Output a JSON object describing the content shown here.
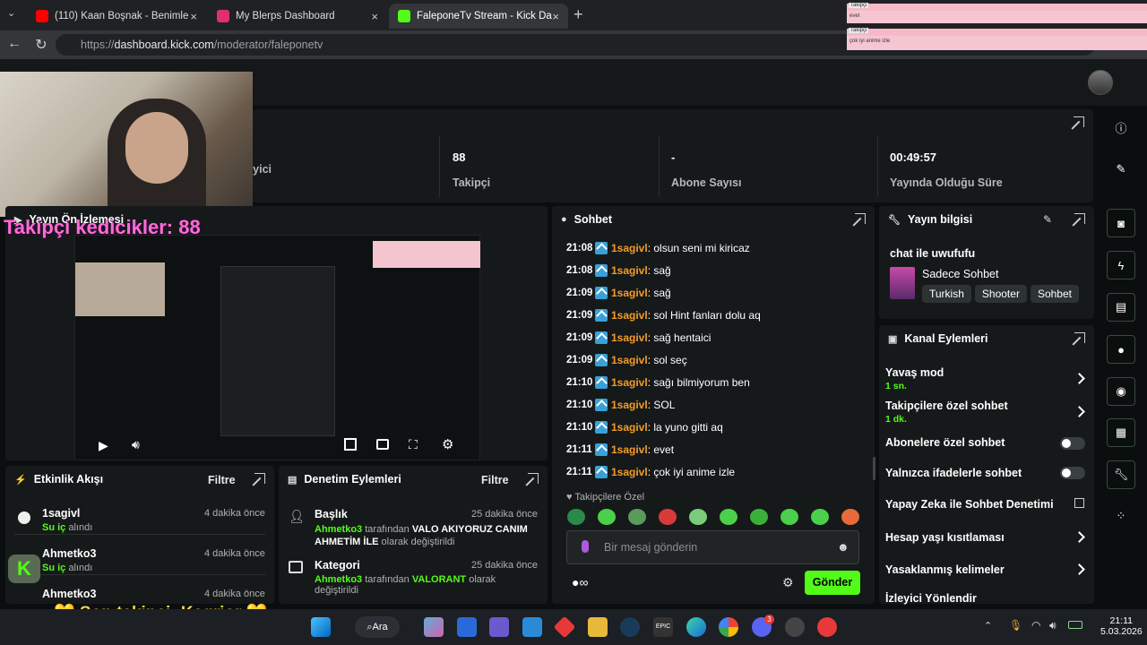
{
  "browser": {
    "tabs": [
      {
        "title": "(110) Kaan Boşnak - Benimle Kaybo",
        "color": "#ff0000"
      },
      {
        "title": "My Blerps Dashboard",
        "color": "#e0306b"
      },
      {
        "title": "FaleponeTv Stream - Kick Dashboa",
        "color": "#53fc18"
      }
    ],
    "url_prefix": "https://",
    "url_host": "dashboard.kick.com",
    "url_path": "/moderator/faleponetv",
    "new_tab": "+"
  },
  "overlay": {
    "notif1_user": "Takipçi",
    "notif1_text": "evet",
    "notif2_user": "Takipçi",
    "notif2_text": "çok iyi anime izle",
    "follower_goal": "Takipçi kedicikler: 88",
    "last_follower": "💛 Son takipçi: Kagrior 💛"
  },
  "stats": [
    {
      "value": "",
      "label": "İzleyici"
    },
    {
      "value": "88",
      "label": "Takipçi"
    },
    {
      "value": "-",
      "label": "Abone Sayısı"
    },
    {
      "value": "00:49:57",
      "label": "Yayında Olduğu Süre"
    }
  ],
  "preview": {
    "title": "Yayın Ön İzlemesi"
  },
  "chat": {
    "title": "Sohbet",
    "messages": [
      {
        "time": "21:08",
        "user": "1sagivl",
        "text": ": olsun seni mi kiricaz"
      },
      {
        "time": "21:08",
        "user": "1sagivl",
        "text": ": sağ"
      },
      {
        "time": "21:09",
        "user": "1sagivl",
        "text": ": sağ"
      },
      {
        "time": "21:09",
        "user": "1sagivl",
        "text": ": sol Hint fanları dolu aq"
      },
      {
        "time": "21:09",
        "user": "1sagivl",
        "text": ": sağ hentaici"
      },
      {
        "time": "21:09",
        "user": "1sagivl",
        "text": ": sol seç"
      },
      {
        "time": "21:10",
        "user": "1sagivl",
        "text": ": sağı bilmiyorum ben"
      },
      {
        "time": "21:10",
        "user": "1sagivl",
        "text": ": SOL"
      },
      {
        "time": "21:10",
        "user": "1sagivl",
        "text": ": la yuno gitti aq"
      },
      {
        "time": "21:11",
        "user": "1sagivl",
        "text": ": evet"
      },
      {
        "time": "21:11",
        "user": "1sagivl",
        "text": ": çok iyi anime izle"
      }
    ],
    "followers_only": "Takipçilere Özel",
    "input_placeholder": "Bir mesaj gönderin",
    "send": "Gönder"
  },
  "stream_info": {
    "title": "Yayın bilgisi",
    "stream_title": "chat ile uwufufu",
    "category": "Sadece Sohbet",
    "tags": [
      "Turkish",
      "Shooter",
      "Sohbet"
    ]
  },
  "channel_actions": {
    "title": "Kanal Eylemleri",
    "slow_mode": "Yavaş mod",
    "slow_mode_val": "1 sn.",
    "followers_chat": "Takipçilere özel sohbet",
    "followers_chat_val": "1 dk.",
    "subs_chat": "Abonelere özel sohbet",
    "emote_chat": "Yalnızca ifadelerle sohbet",
    "ai_mod": "Yapay Zeka ile Sohbet Denetimi",
    "age_limit": "Hesap yaşı kısıtlaması",
    "banned_words": "Yasaklanmış kelimeler",
    "raid": "İzleyici Yönlendir"
  },
  "activity": {
    "title": "Etkinlik Akışı",
    "filter": "Filtre",
    "items": [
      {
        "user": "1sagivl",
        "action": "Su iç",
        "suffix": " alındı",
        "time": "4 dakika önce"
      },
      {
        "user": "Ahmetko3",
        "action": "Su iç",
        "suffix": " alındı",
        "time": "4 dakika önce"
      },
      {
        "user": "Ahmetko3",
        "action": "",
        "suffix": "",
        "time": "4 dakika önce"
      }
    ]
  },
  "moderation": {
    "title": "Denetim Eylemleri",
    "filter": "Filtre",
    "items": [
      {
        "label": "Başlık",
        "time": "25 dakika önce",
        "by": "Ahmetko3",
        "mid": " tarafından ",
        "value": "VALO AKIYORUZ CANIM AHMETİM İLE",
        "end": " olarak değiştirildi"
      },
      {
        "label": "Kategori",
        "time": "25 dakika önce",
        "by": "Ahmetko3",
        "mid": " tarafından ",
        "value": "VALORANT",
        "end": " olarak değiştirildi"
      }
    ]
  },
  "taskbar": {
    "search": "Ara",
    "time": "21:11",
    "date": "5.03.2026",
    "discord_badge": "3"
  },
  "colors": {
    "accent": "#53fc18",
    "username": "#f39c26",
    "panel": "#16191a"
  }
}
